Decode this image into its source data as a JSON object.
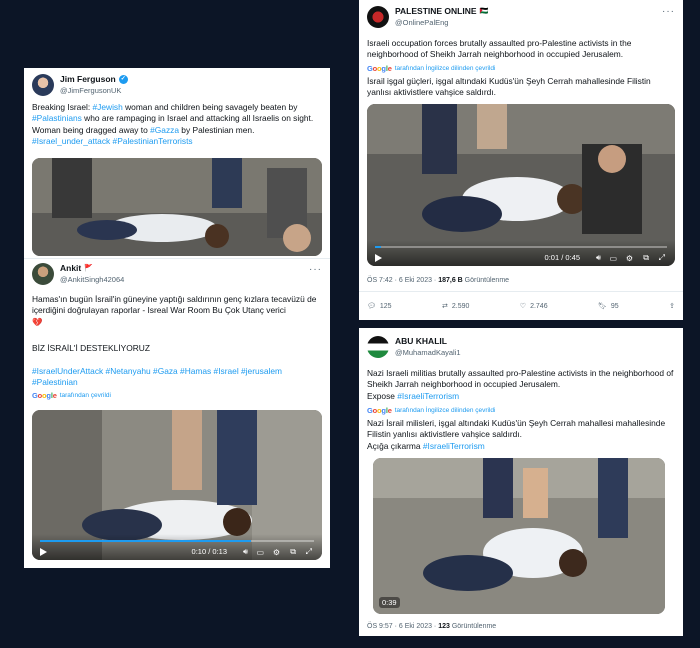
{
  "tweet1": {
    "name": "Jim Ferguson",
    "handle": "@JimFergusonUK",
    "text": [
      {
        "t": "Breaking Israel: ",
        "h": false
      },
      {
        "t": "#Jewish",
        "h": true
      },
      {
        "t": " woman and children being savagely beaten by ",
        "h": false
      },
      {
        "t": "#Palastinians",
        "h": true
      },
      {
        "t": " who are rampaging in Israel and attacking all Israelis on sight. Woman being dragged away to ",
        "h": false
      },
      {
        "t": "#Gazza",
        "h": true
      },
      {
        "t": " by Palestinian men.",
        "h": false
      },
      {
        "t": "#Israel_under_attack #PalestinianTerrorists",
        "h": true,
        "br": true
      }
    ]
  },
  "tweet2": {
    "name": "Ankit",
    "flag": "🚩",
    "handle": "@AnkitSingh42064",
    "text": "Hamas'ın bugün İsrail'in güneyine yaptığı saldırının genç kızlara tecavüzü de içerdiğini doğrulayan raporlar - Isreal War Room Bu Çok Utanç verici",
    "heart": "💔",
    "line2": "BİZ İSRAİL'İ DESTEKLİYORUZ",
    "hashtags": "#IsraelUnderAttack #Netanyahu #Gaza #Hamas #Israel #jerusalem #Palestinian",
    "translate": "tarafından çevrildi",
    "video_time": "0:10 / 0:13",
    "progress": 0.77
  },
  "tweet3": {
    "name": "PALESTINE ONLINE",
    "flag": "🇵🇸",
    "handle": "@OnlinePalEng",
    "text": "Israeli occupation forces brutally assaulted pro-Palestine activists in the neighborhood of Sheikh Jarrah neighborhood in occupied Jerusalem.",
    "translate": "tarafından İngilizce dilinden çevrildi",
    "translated": "İsrail işgal güçleri, işgal altındaki Kudüs'ün Şeyh Cerrah mahallesinde Filistin yanlısı aktivistlere vahşice saldırdı.",
    "video_time": "0:01 / 0:45",
    "progress": 0.02,
    "meta_time": "ÖS 7:42 · 6 Eki 2023 · ",
    "views": "187,6 B",
    "views_label": " Görüntülenme",
    "replies": "125",
    "retweets": "2.590",
    "likes": "2.746",
    "bookmarks": "95"
  },
  "tweet4": {
    "name": "ABU KHALIL",
    "handle": "@MuhamadKayali1",
    "text": "Nazi Israeli militias brutally assaulted pro-Palestine activists in the neighborhood of Sheikh Jarrah neighborhood in occupied Jerusalem.",
    "expose": "Expose ",
    "expose_tag": "#IsraeliTerrorism",
    "translate": "tarafından İngilizce dilinden çevrildi",
    "translated": "Nazi İsrail milisleri, işgal altındaki Kudüs'ün Şeyh Cerrah mahallesi mahallesinde Filistin yanlısı aktivistlere vahşice saldırdı.",
    "expose_tr": "Açığa çıkarma ",
    "video_badge": "0:39",
    "meta_time": "ÖS 9:57 · 6 Eki 2023 · ",
    "views": "123",
    "views_label": " Görüntülenme"
  },
  "google": "Google",
  "colors": {
    "link": "#1d9bf0",
    "background": "#0c1526",
    "verified": "#1d9bf0"
  }
}
